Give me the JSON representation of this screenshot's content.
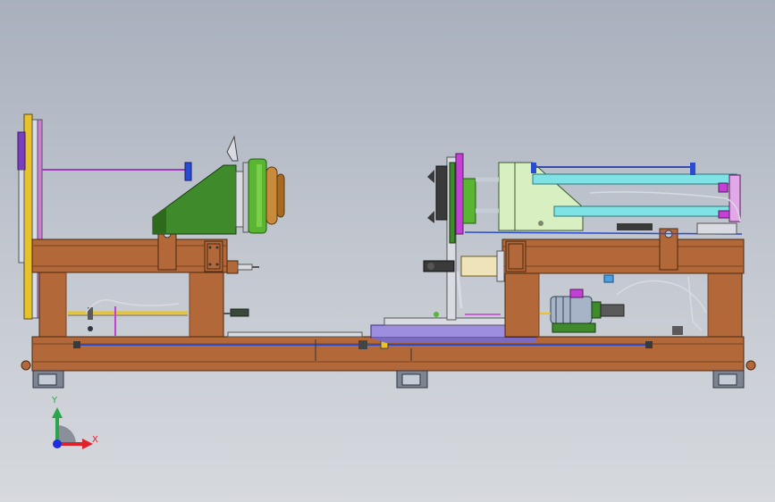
{
  "viewport": {
    "scene": "cad-assembly-side-view",
    "background_top": "#a9b0bd",
    "background_bottom": "#d6d9de"
  },
  "colors": {
    "frame": "#b3683a",
    "frame_dark": "#7a4420",
    "green_housing": "#3f8a2a",
    "bronze_flange": "#c88a3b",
    "yellow_plate": "#e8c22a",
    "cyan_rod": "#7fe3e6",
    "blue_rod": "#2b4bd0",
    "magenta": "#c43fd6",
    "motor": "#a7b4c8",
    "light_green_bracket": "#d8efc2",
    "shaft_cream": "#efe4b9"
  },
  "triad": {
    "x_label": "X",
    "y_label": "Y",
    "x_color": "#e0202a",
    "y_color": "#2aa548",
    "z_color": "#1c2fe0"
  }
}
